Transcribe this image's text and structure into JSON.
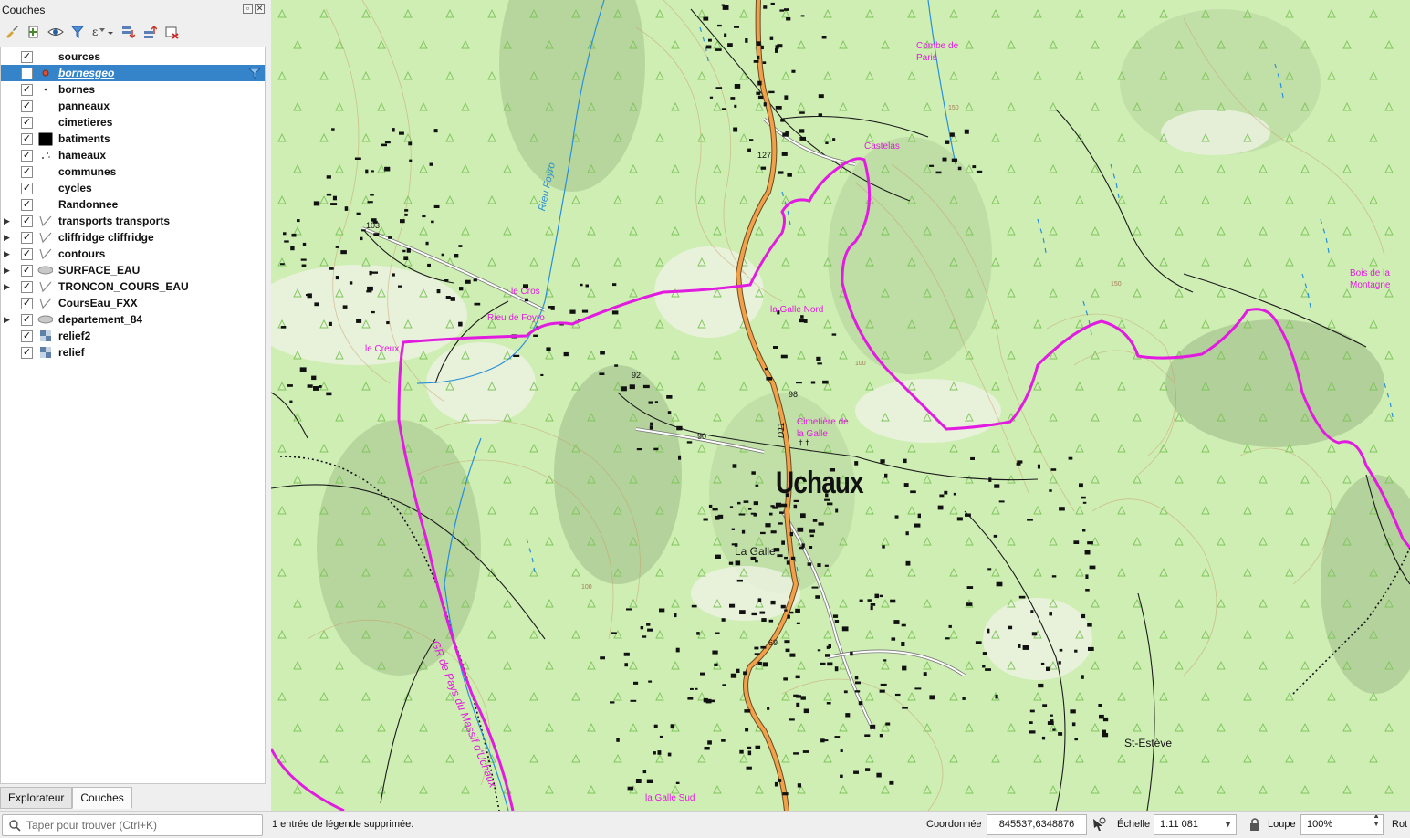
{
  "panel": {
    "title": "Couches",
    "layers": [
      {
        "name": "sources",
        "checked": true,
        "expandable": false,
        "symbol": "none",
        "selected": false
      },
      {
        "name": "bornesgeo",
        "checked": false,
        "expandable": false,
        "symbol": "point-red",
        "selected": true,
        "filtered": true
      },
      {
        "name": "bornes",
        "checked": true,
        "expandable": false,
        "symbol": "point-small",
        "selected": false
      },
      {
        "name": "panneaux",
        "checked": true,
        "expandable": false,
        "symbol": "none",
        "selected": false
      },
      {
        "name": "cimetieres",
        "checked": true,
        "expandable": false,
        "symbol": "none",
        "selected": false
      },
      {
        "name": "batiments",
        "checked": true,
        "expandable": false,
        "symbol": "fill-black",
        "selected": false
      },
      {
        "name": "hameaux",
        "checked": true,
        "expandable": false,
        "symbol": "points-scatter",
        "selected": false
      },
      {
        "name": "communes",
        "checked": true,
        "expandable": false,
        "symbol": "none",
        "selected": false
      },
      {
        "name": "cycles",
        "checked": true,
        "expandable": false,
        "symbol": "none",
        "selected": false
      },
      {
        "name": "Randonnee",
        "checked": true,
        "expandable": false,
        "symbol": "none",
        "selected": false
      },
      {
        "name": "transports transports",
        "checked": true,
        "expandable": true,
        "symbol": "line",
        "selected": false
      },
      {
        "name": "cliffridge cliffridge",
        "checked": true,
        "expandable": true,
        "symbol": "line",
        "selected": false
      },
      {
        "name": "contours",
        "checked": true,
        "expandable": true,
        "symbol": "line",
        "selected": false
      },
      {
        "name": "SURFACE_EAU",
        "checked": true,
        "expandable": true,
        "symbol": "polygon",
        "selected": false
      },
      {
        "name": "TRONCON_COURS_EAU",
        "checked": true,
        "expandable": true,
        "symbol": "line",
        "selected": false
      },
      {
        "name": "CoursEau_FXX",
        "checked": true,
        "expandable": false,
        "symbol": "line",
        "selected": false
      },
      {
        "name": "departement_84",
        "checked": true,
        "expandable": true,
        "symbol": "polygon",
        "selected": false
      },
      {
        "name": "relief2",
        "checked": true,
        "expandable": false,
        "symbol": "raster",
        "selected": false
      },
      {
        "name": "relief",
        "checked": true,
        "expandable": false,
        "symbol": "raster",
        "selected": false
      }
    ],
    "tabs": [
      {
        "label": "Explorateur",
        "active": false
      },
      {
        "label": "Couches",
        "active": true
      }
    ]
  },
  "map": {
    "town_label": "Uchaux",
    "place_labels": {
      "combe_de_paris_1": "Combe de",
      "combe_de_paris_2": "Paris",
      "castelas": "Castelas",
      "bois_1": "Bois de la",
      "bois_2": "Montagne",
      "le_cros": "le Cros",
      "rieu_de_foyro": "Rieu de Foyro",
      "le_creux": "le Creux",
      "la_galle_nord": "la Galle Nord",
      "cimetiere_1": "Cimetière de",
      "cimetiere_2": "la Galle",
      "la_galle": "La Galle",
      "st_esteve": "St-Estève",
      "la_galle_sud": "la Galle Sud",
      "river_name": "Rieu Foyro",
      "trail_name": "GR de Pays du Massif d'Uchaux",
      "road_ref": "D11"
    },
    "elevations": {
      "e127": "127",
      "e103": "103",
      "e92": "92",
      "e90": "90",
      "e98": "98",
      "e69": "69"
    },
    "contour_values": {
      "c150": "150",
      "c100": "100"
    },
    "colors": {
      "background": "#cfeeb4",
      "forest_symbol": "#7fc45c",
      "trail": "#e21be0",
      "road": "#f2a14b",
      "water": "#2a8fd8",
      "contour": "#c99a6a"
    }
  },
  "status": {
    "search_placeholder": "Taper pour trouver (Ctrl+K)",
    "message": "1 entrée de légende supprimée.",
    "coord_label": "Coordonnée",
    "coord_value": "845537,6348876",
    "scale_label": "Échelle",
    "scale_value": "1:11 081",
    "magnifier_label": "Loupe",
    "magnifier_value": "100%",
    "rotation_label": "Rot"
  }
}
